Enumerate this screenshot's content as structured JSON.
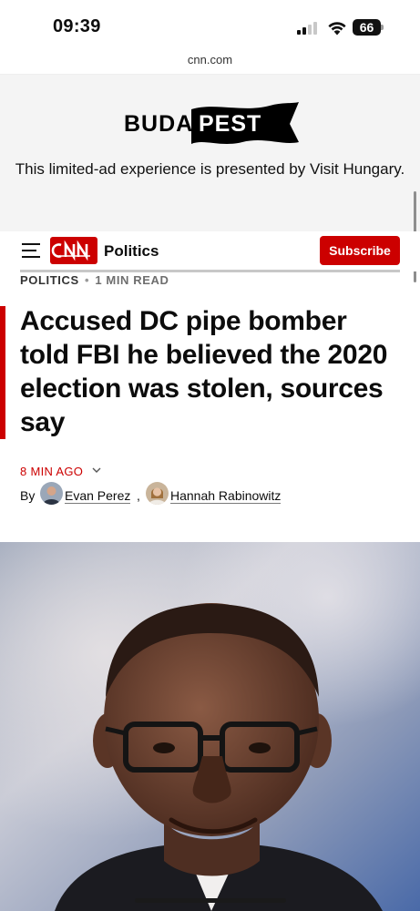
{
  "status_bar": {
    "time": "09:39",
    "battery_level": "66",
    "icons": [
      "signal-icon",
      "wifi-icon",
      "battery-icon"
    ]
  },
  "browser": {
    "url": "cnn.com"
  },
  "ad_banner": {
    "logo_text_left": "BUDA",
    "logo_text_right": "PEST",
    "message": "This limited-ad experience is presented by Visit Hungary."
  },
  "nav": {
    "menu_icon": "hamburger-menu-icon",
    "brand": "CNN",
    "section": "Politics",
    "subscribe_label": "Subscribe",
    "accent_color": "#cc0000"
  },
  "article": {
    "kicker_section": "POLITICS",
    "kicker_separator": "•",
    "read_time": "1 MIN READ",
    "headline": "Accused DC pipe bomber told FBI he believed the 2020 election was stolen, sources say",
    "timestamp": "8 MIN AGO",
    "byline_prefix": "By",
    "authors": [
      {
        "name": "Evan Perez"
      },
      {
        "name": "Hannah Rabinowitz"
      }
    ],
    "byline_separator": ","
  },
  "hero_image": {
    "description_icon": "portrait-photo"
  }
}
